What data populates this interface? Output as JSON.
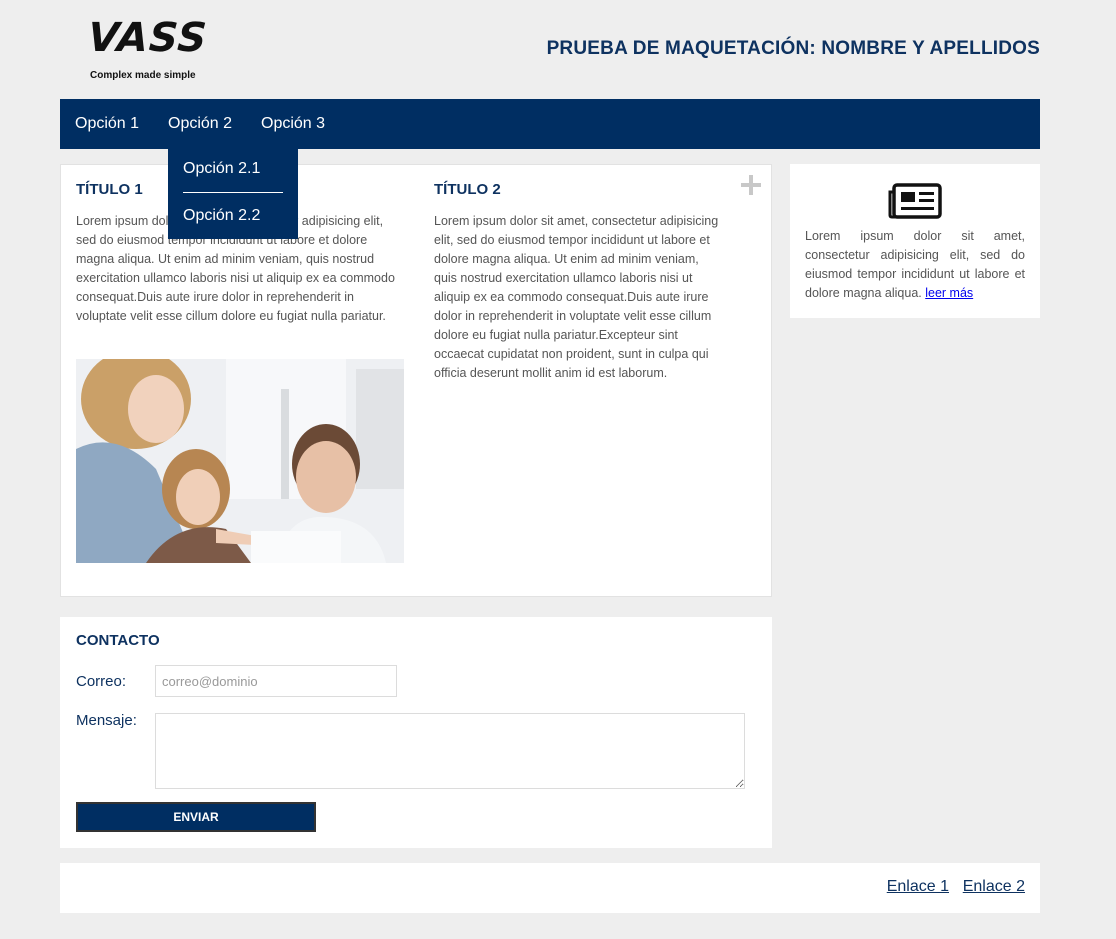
{
  "header": {
    "logo_text": "VASS",
    "logo_tagline": "Complex made simple",
    "page_title": "PRUEBA DE MAQUETACIÓN: NOMBRE Y APELLIDOS"
  },
  "nav": {
    "items": [
      {
        "label": "Opción 1"
      },
      {
        "label": "Opción 2"
      },
      {
        "label": "Opción 3"
      }
    ],
    "dropdown": [
      {
        "label": "Opción 2.1"
      },
      {
        "label": "Opción 2.2"
      }
    ]
  },
  "main": {
    "col1": {
      "title": "TÍTULO 1",
      "text": "Lorem ipsum dolor sit amet, consectetur adipisicing elit, sed do eiusmod tempor incididunt ut labore et dolore magna aliqua. Ut enim ad minim veniam, quis nostrud exercitation ullamco laboris nisi ut aliquip ex ea commodo consequat.Duis aute irure dolor in reprehenderit in voluptate velit esse cillum dolore eu fugiat nulla pariatur."
    },
    "col2": {
      "title": "TÍTULO 2",
      "text": "Lorem ipsum dolor sit amet, consectetur adipisicing elit, sed do eiusmod tempor incididunt ut labore et dolore magna aliqua. Ut enim ad minim veniam, quis nostrud exercitation ullamco laboris nisi ut aliquip ex ea commodo consequat.Duis aute irure dolor in reprehenderit in voluptate velit esse cillum dolore eu fugiat nulla pariatur.Excepteur sint occaecat cupidatat non proident, sunt in culpa qui officia deserunt mollit anim id est laborum."
    },
    "plus_icon": "plus-icon"
  },
  "sidebar": {
    "icon": "newspaper-icon",
    "text": "Lorem ipsum dolor sit amet, consectetur adipisicing elit, sed do eiusmod tempor incididunt ut labore et dolore magna aliqua.",
    "link": "leer más"
  },
  "contact": {
    "title": "CONTACTO",
    "email_label": "Correo:",
    "email_placeholder": "correo@dominio",
    "email_value": "",
    "message_label": "Mensaje:",
    "message_value": "",
    "send_label": "ENVIAR"
  },
  "footer": {
    "links": [
      {
        "label": "Enlace 1"
      },
      {
        "label": "Enlace 2"
      }
    ]
  },
  "colors": {
    "primary": "#002e62",
    "title": "#0e3260",
    "background": "#eeeeee",
    "panel": "#ffffff"
  }
}
